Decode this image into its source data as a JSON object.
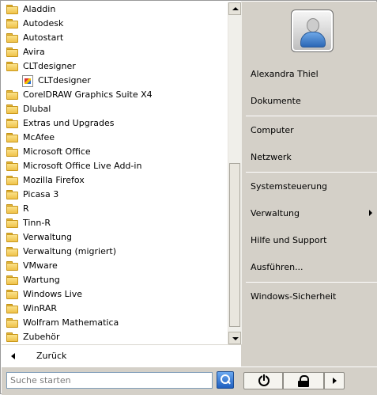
{
  "programs": [
    {
      "label": "Aladdin",
      "type": "folder"
    },
    {
      "label": "Autodesk",
      "type": "folder"
    },
    {
      "label": "Autostart",
      "type": "folder"
    },
    {
      "label": "Avira",
      "type": "folder"
    },
    {
      "label": "CLTdesigner",
      "type": "folder"
    },
    {
      "label": "CLTdesigner",
      "type": "app"
    },
    {
      "label": "CorelDRAW Graphics Suite X4",
      "type": "folder"
    },
    {
      "label": "Dlubal",
      "type": "folder"
    },
    {
      "label": "Extras und Upgrades",
      "type": "folder"
    },
    {
      "label": "McAfee",
      "type": "folder"
    },
    {
      "label": "Microsoft Office",
      "type": "folder"
    },
    {
      "label": "Microsoft Office Live Add-in",
      "type": "folder"
    },
    {
      "label": "Mozilla Firefox",
      "type": "folder"
    },
    {
      "label": "Picasa 3",
      "type": "folder"
    },
    {
      "label": "R",
      "type": "folder"
    },
    {
      "label": "Tinn-R",
      "type": "folder"
    },
    {
      "label": "Verwaltung",
      "type": "folder"
    },
    {
      "label": "Verwaltung (migriert)",
      "type": "folder"
    },
    {
      "label": "VMware",
      "type": "folder"
    },
    {
      "label": "Wartung",
      "type": "folder"
    },
    {
      "label": "Windows Live",
      "type": "folder"
    },
    {
      "label": "WinRAR",
      "type": "folder"
    },
    {
      "label": "Wolfram Mathematica",
      "type": "folder"
    },
    {
      "label": "Zubehör",
      "type": "folder"
    }
  ],
  "back": {
    "label": "Zurück"
  },
  "right_pane": {
    "user_name": "Alexandra Thiel",
    "documents": "Dokumente",
    "computer": "Computer",
    "network": "Netzwerk",
    "control_panel": "Systemsteuerung",
    "administration": "Verwaltung",
    "help": "Hilfe und Support",
    "run": "Ausführen...",
    "security": "Windows-Sicherheit"
  },
  "search": {
    "placeholder": "Suche starten",
    "value": ""
  },
  "icons": {
    "folder": "folder-icon",
    "app": "application-icon",
    "user": "user-avatar-icon",
    "search": "search-icon",
    "power": "power-icon",
    "lock": "lock-icon",
    "more": "chevron-right-icon"
  }
}
